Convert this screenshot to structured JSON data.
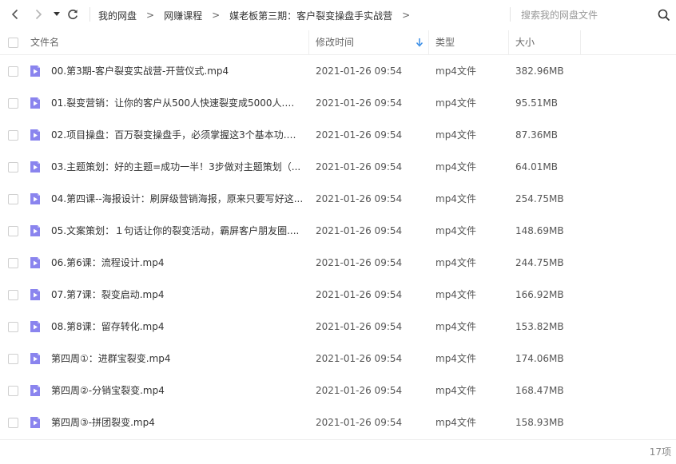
{
  "nav": {
    "back_icon": "chevron-left-icon",
    "forward_icon": "chevron-right-icon",
    "history_icon": "caret-down-icon",
    "refresh_icon": "refresh-icon"
  },
  "breadcrumb": {
    "items": [
      "我的网盘",
      "网赚课程",
      "媒老板第三期：客户裂变操盘手实战营"
    ],
    "separator": ">"
  },
  "search": {
    "placeholder": "搜索我的网盘文件",
    "icon": "search-icon"
  },
  "table": {
    "columns": {
      "name": "文件名",
      "modified": "修改时间",
      "type": "类型",
      "size": "大小"
    },
    "sort_indicator": "arrow-down-icon",
    "rows": [
      {
        "name": "00.第3期-客户裂变实战营-开营仪式.mp4",
        "modified": "2021-01-26 09:54",
        "type": "mp4文件",
        "size": "382.96MB"
      },
      {
        "name": "01.裂变营销：让你的客户从500人快速裂变成5000人.mp4",
        "modified": "2021-01-26 09:54",
        "type": "mp4文件",
        "size": "95.51MB"
      },
      {
        "name": "02.项目操盘：百万裂变操盘手，必须掌握这3个基本功.m...",
        "modified": "2021-01-26 09:54",
        "type": "mp4文件",
        "size": "87.36MB"
      },
      {
        "name": "03.主题策划：好的主题=成功一半！3步做对主题策划（...",
        "modified": "2021-01-26 09:54",
        "type": "mp4文件",
        "size": "64.01MB"
      },
      {
        "name": "04.第四课--海报设计：刷屏级营销海报，原来只要写好这...",
        "modified": "2021-01-26 09:54",
        "type": "mp4文件",
        "size": "254.75MB"
      },
      {
        "name": "05.文案策划：１句话让你的裂变活动，霸屏客户朋友圈....",
        "modified": "2021-01-26 09:54",
        "type": "mp4文件",
        "size": "148.69MB"
      },
      {
        "name": "06.第6课：流程设计.mp4",
        "modified": "2021-01-26 09:54",
        "type": "mp4文件",
        "size": "244.75MB"
      },
      {
        "name": "07.第7课：裂变启动.mp4",
        "modified": "2021-01-26 09:54",
        "type": "mp4文件",
        "size": "166.92MB"
      },
      {
        "name": "08.第8课：留存转化.mp4",
        "modified": "2021-01-26 09:54",
        "type": "mp4文件",
        "size": "153.82MB"
      },
      {
        "name": "第四周①：进群宝裂变.mp4",
        "modified": "2021-01-26 09:54",
        "type": "mp4文件",
        "size": "174.06MB"
      },
      {
        "name": "第四周②-分销宝裂变.mp4",
        "modified": "2021-01-26 09:54",
        "type": "mp4文件",
        "size": "168.47MB"
      },
      {
        "name": "第四周③-拼团裂变.mp4",
        "modified": "2021-01-26 09:54",
        "type": "mp4文件",
        "size": "158.93MB"
      }
    ]
  },
  "footer": {
    "count": "17项"
  },
  "colors": {
    "video_icon": "#8a84ee",
    "sort_arrow": "#3a8ee6",
    "divider": "#eeeeee"
  }
}
